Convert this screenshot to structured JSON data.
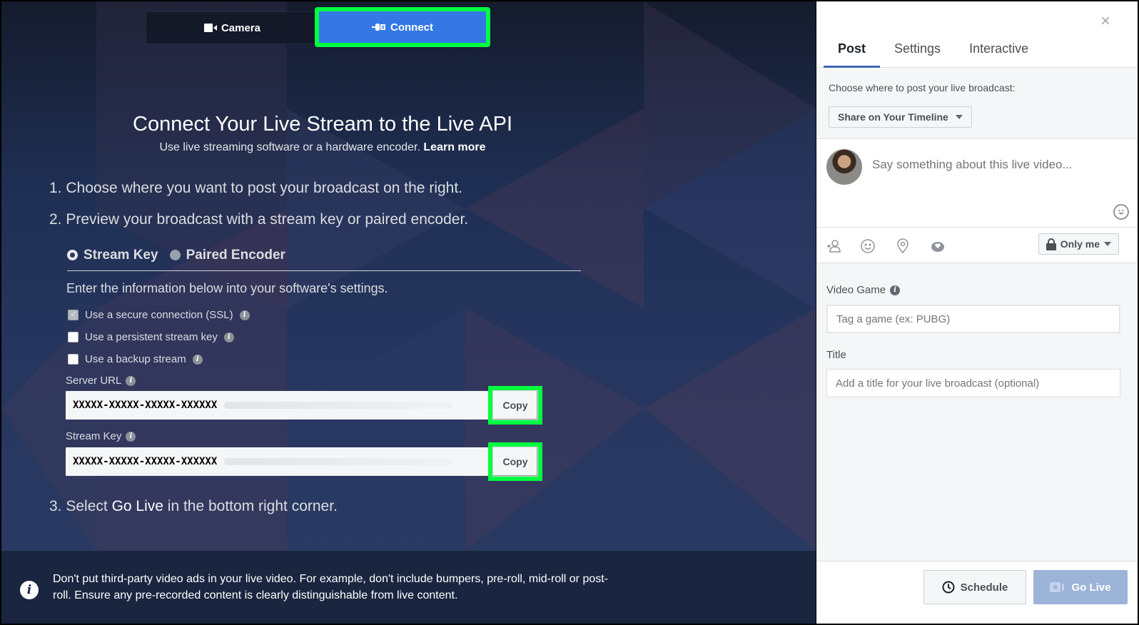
{
  "colors": {
    "accent": "#3578e5",
    "highlight": "#00ff41",
    "tab_underline": "#4267b2",
    "go_live_disabled": "#9cb4d8"
  },
  "mode_tabs": [
    {
      "label": "Camera",
      "icon": "video-camera-icon",
      "active": false
    },
    {
      "label": "Connect",
      "icon": "plug-icon",
      "active": true
    }
  ],
  "main": {
    "title": "Connect Your Live Stream to the Live API",
    "subtitle": "Use live streaming software or a hardware encoder.",
    "learn_more": "Learn more",
    "step1": "1. Choose where you want to post your broadcast on the right.",
    "step2": "2. Preview your broadcast with a stream key or paired encoder.",
    "step3_prefix": "3. Select",
    "step3_strong": "Go Live",
    "step3_suffix": "in the bottom right corner.",
    "radios": [
      {
        "label": "Stream Key",
        "selected": true
      },
      {
        "label": "Paired Encoder",
        "selected": false
      }
    ],
    "instructions": "Enter the information below into your software's settings.",
    "checkboxes": [
      {
        "label": "Use a secure connection (SSL)",
        "checked": true,
        "disabled": true
      },
      {
        "label": "Use a persistent stream key",
        "checked": false,
        "disabled": false
      },
      {
        "label": "Use a backup stream",
        "checked": false,
        "disabled": false
      }
    ],
    "server_url": {
      "label": "Server URL",
      "value": "XXXXX-XXXXX-XXXXX-XXXXXX",
      "copy": "Copy"
    },
    "stream_key": {
      "label": "Stream Key",
      "value": "XXXXX-XXXXX-XXXXX-XXXXXX",
      "copy": "Copy"
    },
    "notice": "Don't put third-party video ads in your live video. For example, don't include bumpers, pre-roll, mid-roll or post-roll. Ensure any pre-recorded content is clearly distinguishable from live content."
  },
  "panel": {
    "close_icon": "×",
    "tabs": [
      {
        "label": "Post",
        "active": true
      },
      {
        "label": "Settings",
        "active": false
      },
      {
        "label": "Interactive",
        "active": false
      }
    ],
    "destination_label": "Choose where to post your live broadcast:",
    "destination_value": "Share on Your Timeline",
    "composer_placeholder": "Say something about this live video...",
    "privacy": "Only me",
    "video_game_label": "Video Game",
    "video_game_placeholder": "Tag a game (ex: PUBG)",
    "title_label": "Title",
    "title_placeholder": "Add a title for your live broadcast (optional)",
    "schedule": "Schedule",
    "go_live": "Go Live"
  }
}
